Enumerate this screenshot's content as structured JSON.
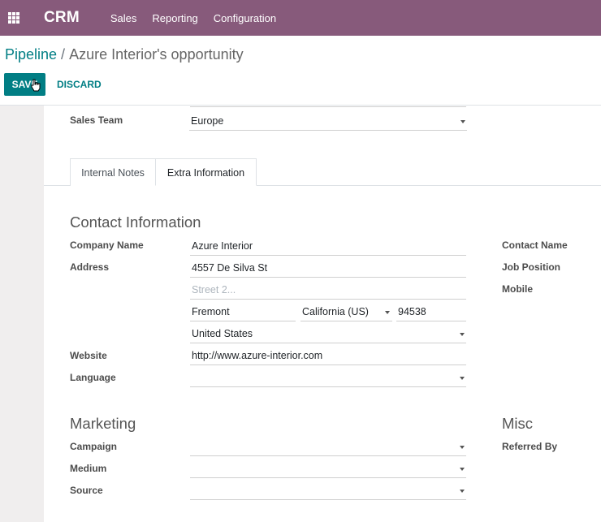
{
  "navbar": {
    "brand": "CRM",
    "menu": [
      "Sales",
      "Reporting",
      "Configuration"
    ]
  },
  "breadcrumb": {
    "parent": "Pipeline",
    "separator": "/",
    "current": "Azure Interior's opportunity"
  },
  "actions": {
    "save": "SAVE",
    "discard": "DISCARD"
  },
  "form": {
    "sales_team": {
      "label": "Sales Team",
      "value": "Europe"
    }
  },
  "tabs": [
    {
      "label": "Internal Notes",
      "active": false
    },
    {
      "label": "Extra Information",
      "active": true
    }
  ],
  "contact_info": {
    "title": "Contact Information",
    "company_name": {
      "label": "Company Name",
      "value": "Azure Interior"
    },
    "address": {
      "label": "Address",
      "street": "4557 De Silva St",
      "street2_placeholder": "Street 2...",
      "city": "Fremont",
      "state": "California (US)",
      "zip": "94538",
      "country": "United States"
    },
    "website": {
      "label": "Website",
      "value": "http://www.azure-interior.com"
    },
    "language": {
      "label": "Language",
      "value": ""
    },
    "right_labels": [
      "Contact Name",
      "Job Position",
      "Mobile"
    ]
  },
  "marketing": {
    "title": "Marketing",
    "campaign": {
      "label": "Campaign",
      "value": ""
    },
    "medium": {
      "label": "Medium",
      "value": ""
    },
    "source": {
      "label": "Source",
      "value": ""
    }
  },
  "misc": {
    "title": "Misc",
    "referred_by": {
      "label": "Referred By"
    }
  },
  "colors": {
    "navbar": "#875a7b",
    "primary": "#017e84"
  }
}
